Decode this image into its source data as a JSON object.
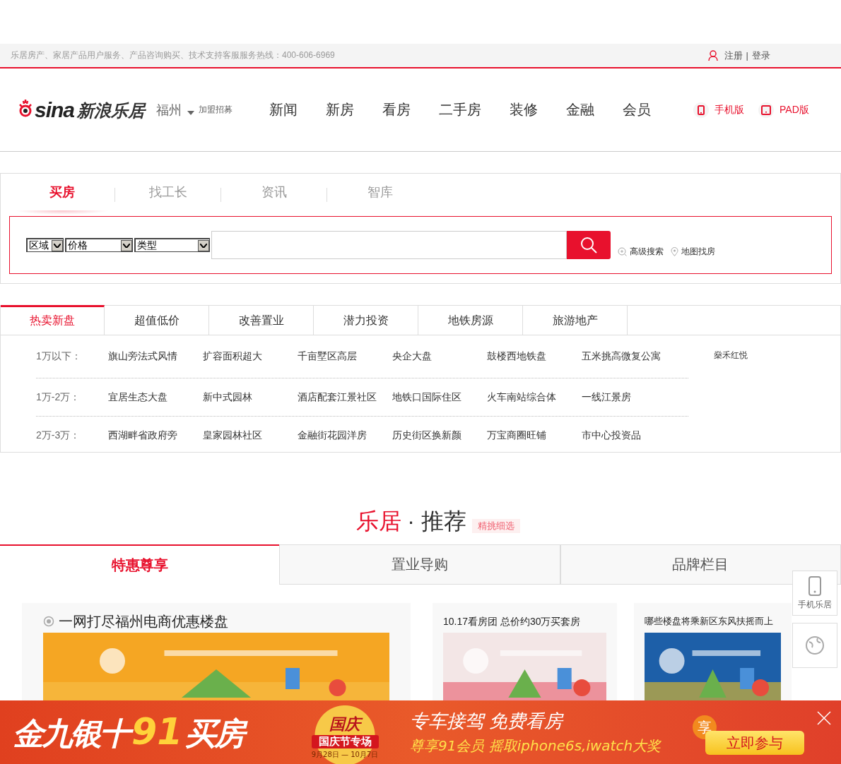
{
  "top_bar": {
    "hotline": "乐居房产、家居产品用户服务、产品咨询购买、技术支持客服服务热线：400-606-6969",
    "register": "注册",
    "separator": "|",
    "login": "登录"
  },
  "header": {
    "logo_mark": "sina",
    "logo_text": "新浪乐居",
    "city": "福州",
    "join": "加盟招募",
    "nav": [
      "新闻",
      "新房",
      "看房",
      "二手房",
      "装修",
      "金融",
      "会员"
    ],
    "apps": [
      {
        "kind": "phone",
        "label": "手机版"
      },
      {
        "kind": "tablet",
        "label": "PAD版"
      }
    ]
  },
  "search": {
    "tabs": [
      {
        "label": "买房",
        "selected": true
      },
      {
        "label": "找工长",
        "selected": false
      },
      {
        "label": "资讯",
        "selected": false
      },
      {
        "label": "智库",
        "selected": false
      }
    ],
    "filters": [
      "区域",
      "价格",
      "类型"
    ],
    "links": [
      {
        "kind": "advanced",
        "label": "高级搜索"
      },
      {
        "kind": "map",
        "label": "地图找房"
      }
    ]
  },
  "hot": {
    "tabs": [
      {
        "label": "热卖新盘",
        "selected": true
      },
      {
        "label": "超值低价",
        "selected": false
      },
      {
        "label": "改善置业",
        "selected": false
      },
      {
        "label": "潜力投资",
        "selected": false
      },
      {
        "label": "地铁房源",
        "selected": false
      },
      {
        "label": "旅游地产",
        "selected": false
      }
    ],
    "rows": [
      {
        "range": "1万以下：",
        "items": [
          "旗山旁法式风情",
          "扩容面积超大",
          "千亩墅区高层",
          "央企大盘",
          "鼓楼西地铁盘",
          "五米挑高微复公寓"
        ]
      },
      {
        "range": "1万-2万：",
        "items": [
          "宜居生态大盘",
          "新中式园林",
          "酒店配套江景社区",
          "地铁口国际住区",
          "火车南站综合体",
          "一线江景房"
        ]
      },
      {
        "range": "2万-3万：",
        "items": [
          "西湖畔省政府旁",
          "皇家园林社区",
          "金融街花园洋房",
          "历史街区换新颜",
          "万宝商圈旺铺",
          "市中心投资品"
        ]
      }
    ],
    "extra": "燊禾红悦"
  },
  "recommend": {
    "title_accent": "乐居",
    "title_rest": "· 推荐",
    "badge": "精挑细选",
    "tabs": [
      {
        "label": "特惠尊享",
        "selected": true
      },
      {
        "label": "置业导购",
        "selected": false
      },
      {
        "label": "品牌栏目",
        "selected": false
      }
    ],
    "cards": [
      {
        "title": "一网打尽福州电商优惠楼盘",
        "kind": "featured"
      },
      {
        "title": "10.17看房团 总价约30万买套房",
        "kind": "plain"
      },
      {
        "title": "哪些楼盘将乘新区东风扶摇而上",
        "kind": "plain"
      }
    ]
  },
  "side_widget": {
    "label": "手机乐居"
  },
  "promo_banner": {
    "slogan_start": "金九银十",
    "slogan_number": "91",
    "slogan_end": "买房",
    "medal_title": "国庆",
    "medal_ribbon": "国庆节专场",
    "medal_dates": "9月28日 — 10月7日",
    "headline": "专车接驾 免费看房",
    "subline": "尊享91会员 摇取iphone6s,iwatch大奖",
    "badge": "享",
    "cta": "立即参与"
  }
}
